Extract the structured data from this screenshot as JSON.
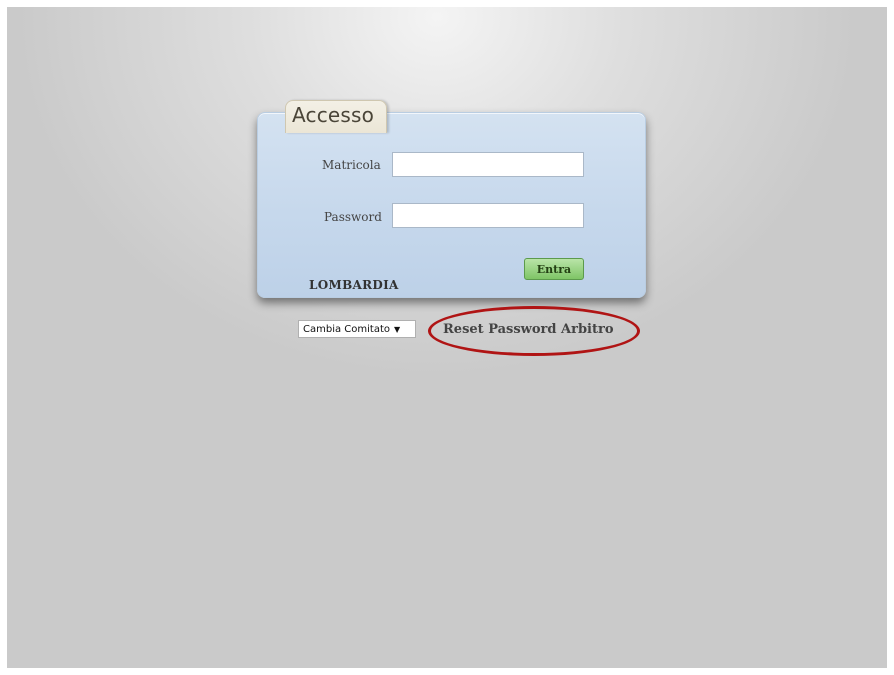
{
  "login": {
    "title": "Accesso",
    "username_label": "Matricola",
    "username_value": "",
    "password_label": "Password",
    "password_value": "",
    "submit_label": "Entra",
    "region_label": "LOMBARDIA"
  },
  "footer": {
    "committee_select_value": "Cambia Comitato",
    "reset_password_label": "Reset Password Arbitro"
  },
  "icons": {
    "select_arrow": "chevron-down-icon"
  },
  "colors": {
    "panel": "#c6d8ec",
    "tab": "#ebe6d6",
    "submit_button": "#7fc566",
    "highlight": "#b01414"
  }
}
